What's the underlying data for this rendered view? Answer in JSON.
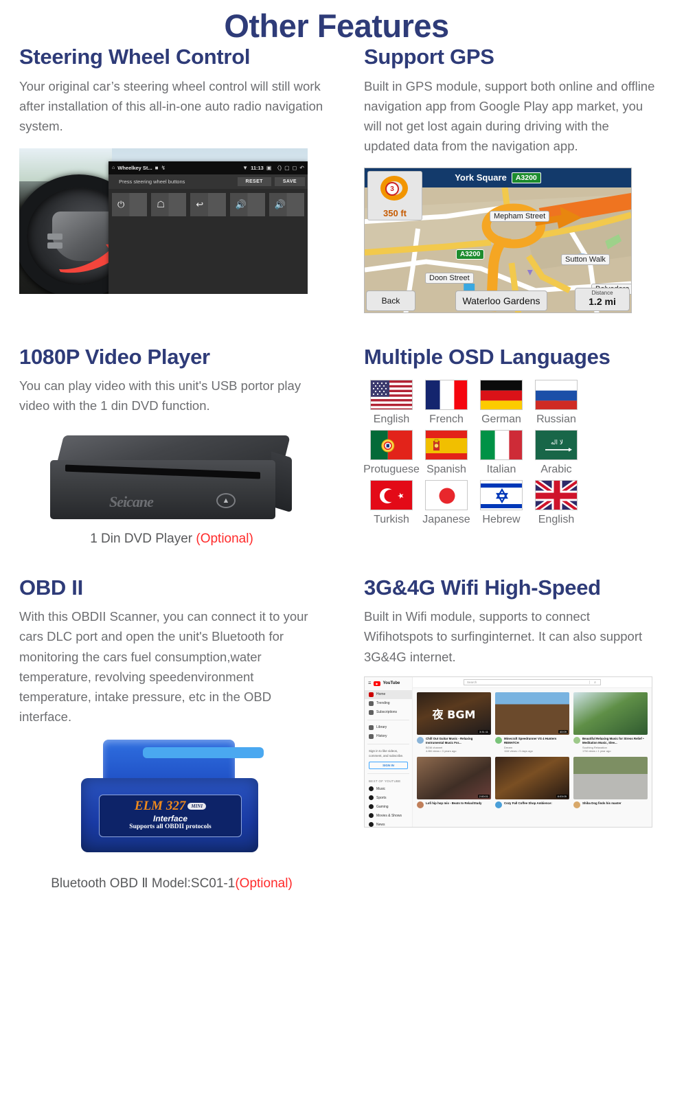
{
  "page": {
    "title": "Other Features",
    "title_color": "#2e3b78",
    "body_color": "#6d6e71",
    "optional_color": "#ff2a2a"
  },
  "features": [
    {
      "id": "steering-wheel-control",
      "title": "Steering Wheel Control",
      "body": "Your original car’s steering wheel control will still work after installation of this all-in-one auto radio navigation system."
    },
    {
      "id": "support-gps",
      "title": "Support GPS",
      "body": "Built in GPS module, support both online and offline navigation app from Google Play app market, you will not get lost again during driving with the updated data from the navigation app."
    },
    {
      "id": "video-player",
      "title": "1080P Video Player",
      "body": "You can play video with this unit's  USB portor play video with the 1 din DVD function."
    },
    {
      "id": "osd-languages",
      "title": "Multiple OSD Languages",
      "body": ""
    },
    {
      "id": "obd-ii",
      "title": "OBD II",
      "body": "With this OBDII Scanner, you can connect it to your cars DLC port and open the unit's Bluetooth for monitoring the cars fuel consumption,water temperature, revolving speedenvironment temperature, intake pressure, etc in the OBD interface."
    },
    {
      "id": "wifi-3g-4g",
      "title": "3G&4G Wifi High-Speed",
      "body": "Built in Wifi module, supports to connect  Wifihotspots to surfinginternet. It can also support 3G&4G internet."
    }
  ],
  "steering_screen": {
    "status_title": "Wheelkey St...",
    "status_time": "11:13",
    "instruction": "Press steering wheel buttons",
    "reset_label": "RESET",
    "save_label": "SAVE",
    "keys": [
      "power-icon",
      "home-icon",
      "back-icon",
      "volume-up-icon",
      "volume-up-icon"
    ],
    "key_glyphs": [
      "⏻",
      "⌂",
      "↩",
      "◂+",
      "◂+"
    ],
    "home_icon": "home-icon",
    "wifi_icon": "wifi-icon",
    "back_nav_icon": "back-nav-icon"
  },
  "gps_map": {
    "header_street": "York Square",
    "header_shield": "A3200",
    "turn_exit_number": "3",
    "turn_distance": "350 ft",
    "labels": [
      "Mepham Street",
      "A3200",
      "Sutton Walk",
      "Doon Street",
      "Belvedere R…"
    ],
    "back_label": "Back",
    "destination_label": "Waterloo Gardens",
    "distance_key": "Distance",
    "distance_value": "1.2 mi"
  },
  "dvd": {
    "brand": "Seicane",
    "eject_icon": "eject-icon",
    "caption_main": "1 Din DVD Player ",
    "caption_optional": "(Optional)"
  },
  "languages": [
    [
      {
        "label": "English",
        "flag": "us-flag"
      },
      {
        "label": "French",
        "flag": "fr-flag"
      },
      {
        "label": "German",
        "flag": "de-flag"
      },
      {
        "label": "Russian",
        "flag": "ru-flag"
      }
    ],
    [
      {
        "label": "Protuguese",
        "flag": "pt-flag"
      },
      {
        "label": "Spanish",
        "flag": "es-flag"
      },
      {
        "label": "Italian",
        "flag": "it-flag"
      },
      {
        "label": "Arabic",
        "flag": "sa-flag"
      }
    ],
    [
      {
        "label": "Turkish",
        "flag": "tr-flag"
      },
      {
        "label": "Japanese",
        "flag": "jp-flag"
      },
      {
        "label": "Hebrew",
        "flag": "il-flag"
      },
      {
        "label": "English",
        "flag": "gb-flag"
      }
    ]
  ],
  "obd_device": {
    "title": "ELM 327",
    "mini_badge": "MINI",
    "subtitle": "Interface",
    "protocols": "Supports all OBDII protocols",
    "caption_main": "Bluetooth OBD Ⅱ Model:SC01-1",
    "caption_optional": "(Optional)"
  },
  "youtube": {
    "brand": "YouTube",
    "menu_icon": "hamburger-icon",
    "logo_icon": "youtube-logo-icon",
    "search_placeholder": "Search",
    "search_icon": "search-icon",
    "nav": [
      {
        "label": "Home",
        "icon": "home-icon",
        "active": true
      },
      {
        "label": "Trending",
        "icon": "trending-icon",
        "active": false
      },
      {
        "label": "Subscriptions",
        "icon": "subscriptions-icon",
        "active": false
      }
    ],
    "nav2": [
      {
        "label": "Library",
        "icon": "library-icon"
      },
      {
        "label": "History",
        "icon": "history-icon"
      }
    ],
    "signin_prompt": "Sign in to like videos, comment, and subscribe.",
    "signin_label": "SIGN IN",
    "signin_icon": "account-icon",
    "section_header": "BEST OF YOUTUBE",
    "categories": [
      {
        "label": "Music",
        "icon": "music-icon"
      },
      {
        "label": "Sports",
        "icon": "sports-icon"
      },
      {
        "label": "Gaming",
        "icon": "gaming-icon"
      },
      {
        "label": "Movies & Shows",
        "icon": "movies-icon"
      },
      {
        "label": "News",
        "icon": "news-icon"
      }
    ],
    "videos_row1": [
      {
        "overlay": "夜 BGM",
        "duration": "3:31:11",
        "title": "Chill Out Guitar Music - Relaxing Instrumental Music For...",
        "channel": "BGM channel",
        "views": "4.8M views • 3 years ago"
      },
      {
        "overlay": "",
        "duration": "40:09",
        "title": "Minecraft Speedrunner VS 4 Hunters REMATCH",
        "channel": "Dream",
        "views": "11M views • 5 days ago"
      },
      {
        "overlay": "",
        "duration": "",
        "title": "Beautiful Relaxing Music for Stress Relief • Meditation Music, Slee...",
        "channel": "Soothing Relaxation",
        "views": "17M views • 1 year ago"
      }
    ],
    "videos_row2": [
      {
        "duration": "2:00:01",
        "title": "Lofi hip hop mix - Beats to Relax/Study",
        "channel": "",
        "views": ""
      },
      {
        "duration": "8:03:05",
        "title": "Cozy Fall Coffee Shop Ambience:",
        "channel": "",
        "views": ""
      },
      {
        "duration": "",
        "title": "Shiba Dog finds his master",
        "channel": "",
        "views": ""
      }
    ]
  }
}
